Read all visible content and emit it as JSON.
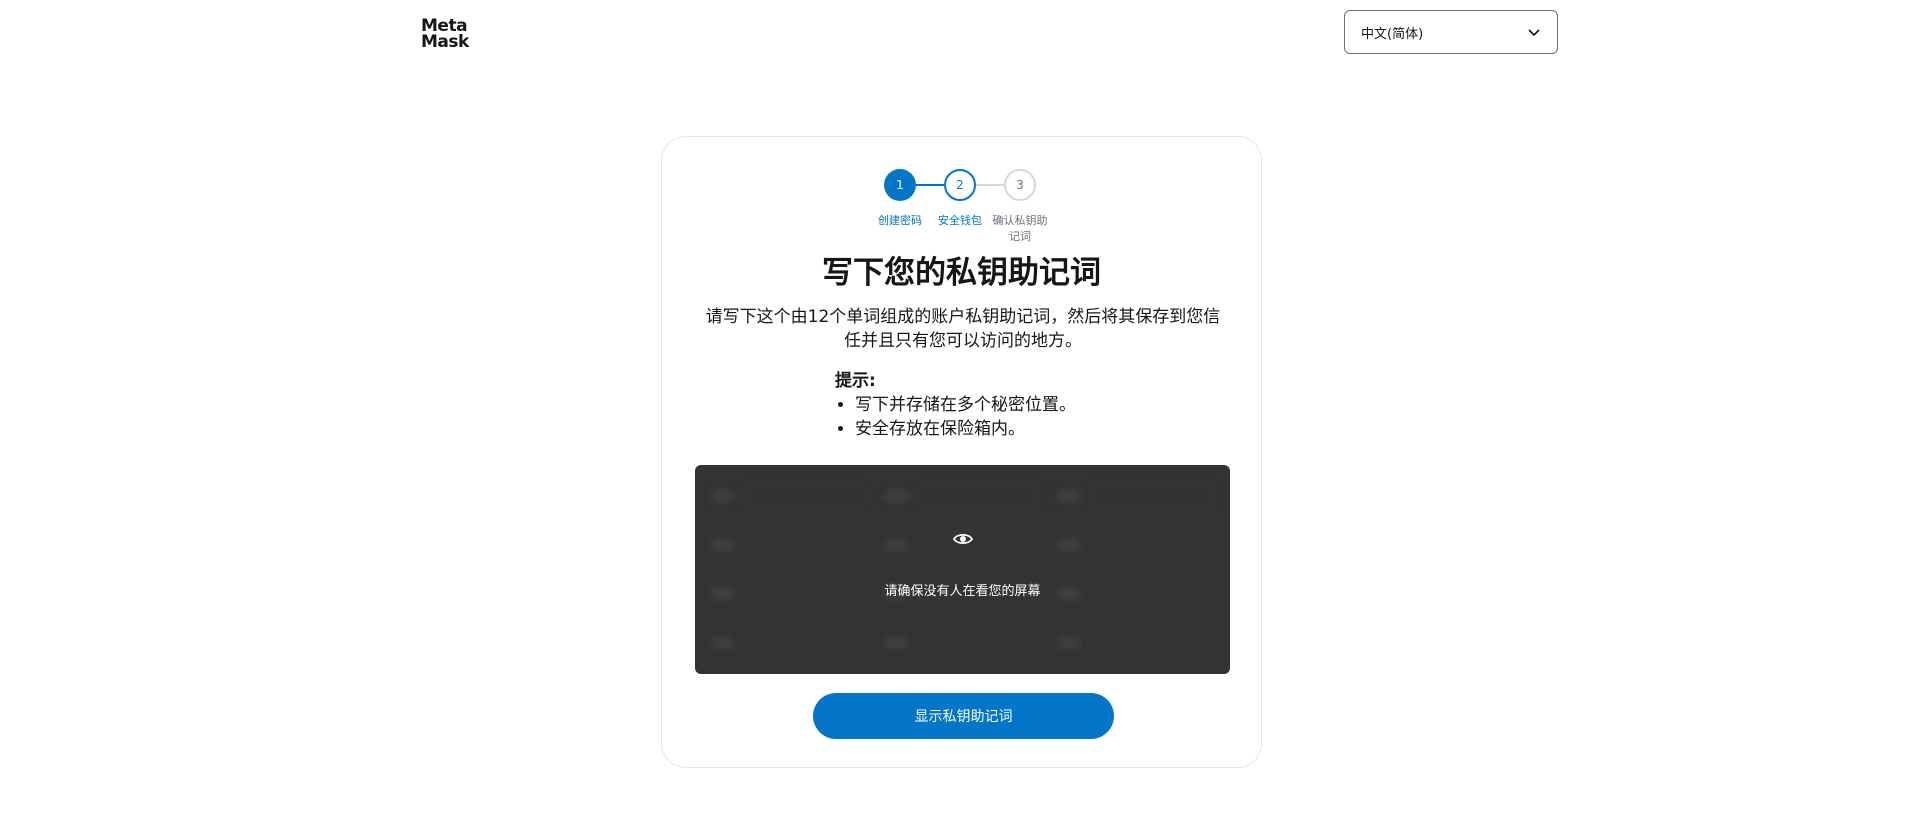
{
  "header": {
    "logo_line1": "Meta",
    "logo_line2": "Mask",
    "language_selected": "中文(简体)"
  },
  "stepper": {
    "steps": [
      {
        "number": "1",
        "label": "创建密码",
        "state": "completed"
      },
      {
        "number": "2",
        "label": "安全钱包",
        "state": "active"
      },
      {
        "number": "3",
        "label": "确认私钥助记词",
        "state": "pending"
      }
    ]
  },
  "content": {
    "title": "写下您的私钥助记词",
    "description": "请写下这个由12个单词组成的账户私钥助记词，然后将其保存到您信任并且只有您可以访问的地方。",
    "tips_title": "提示:",
    "tips": [
      "写下并存储在多个秘密位置。",
      "安全存放在保险箱内。"
    ]
  },
  "srp": {
    "warning": "请确保没有人在看您的屏幕",
    "eye_icon": "eye-icon"
  },
  "actions": {
    "reveal_label": "显示私钥助记词"
  },
  "colors": {
    "primary": "#0376c9",
    "srp_background": "#333333",
    "text": "#141618"
  }
}
